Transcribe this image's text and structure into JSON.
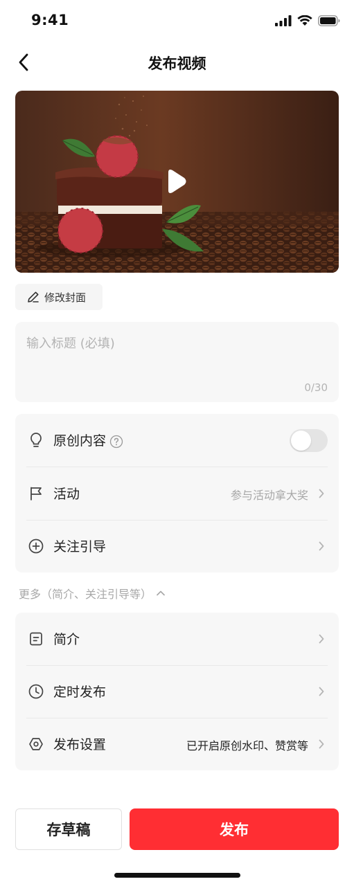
{
  "status_bar": {
    "time": "9:41"
  },
  "nav": {
    "title": "发布视频",
    "back_icon": "chevron-left-icon"
  },
  "cover": {
    "edit_label": "修改封面",
    "play_icon": "play-icon"
  },
  "title_field": {
    "placeholder": "输入标题 (必填)",
    "counter": "0/30"
  },
  "settings_group_1": {
    "items": [
      {
        "label": "原创内容",
        "icon": "lightbulb-icon",
        "help_icon": "question-circle-icon",
        "toggle_on": false
      },
      {
        "label": "活动",
        "icon": "flag-icon",
        "value": "参与活动拿大奖"
      },
      {
        "label": "关注引导",
        "icon": "plus-circle-icon"
      }
    ]
  },
  "more": {
    "label": "更多（简介、关注引导等）"
  },
  "settings_group_2": {
    "items": [
      {
        "label": "简介",
        "icon": "note-icon"
      },
      {
        "label": "定时发布",
        "icon": "clock-icon"
      },
      {
        "label": "发布设置",
        "icon": "settings-hexagon-icon",
        "value": "已开启原创水印、赞赏等"
      }
    ]
  },
  "actions": {
    "draft_label": "存草稿",
    "publish_label": "发布"
  },
  "colors": {
    "accent": "#ff2e33",
    "card_bg": "#f7f7f7",
    "muted_text": "#a8a8a8"
  }
}
